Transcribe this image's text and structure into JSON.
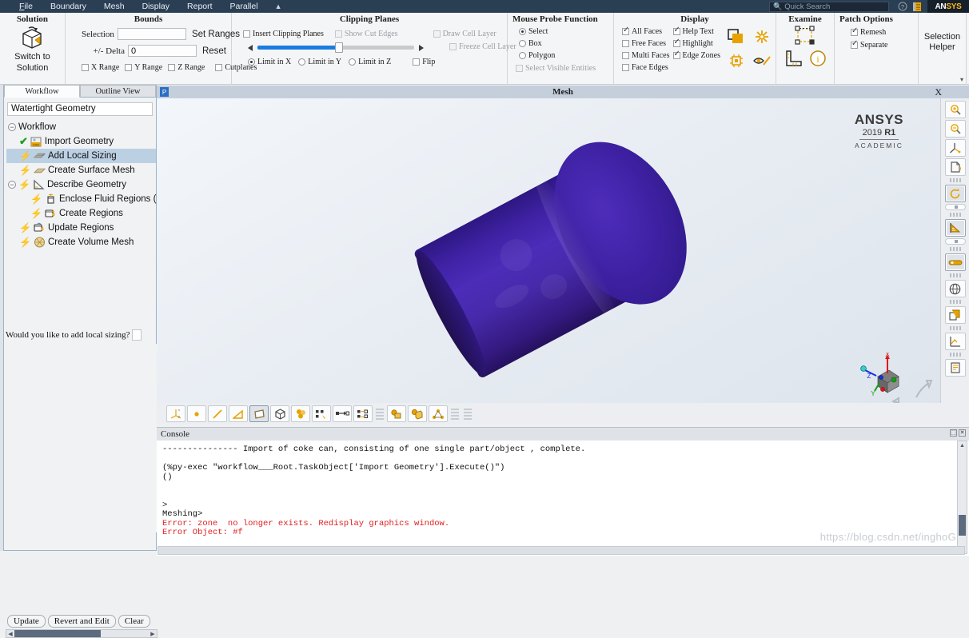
{
  "menubar": {
    "items": [
      "File",
      "Boundary",
      "Mesh",
      "Display",
      "Report",
      "Parallel"
    ],
    "caret": "▲",
    "search_placeholder": "Quick Search",
    "search_icon": "search-icon",
    "help_icon": "help-icon",
    "book_icon": "manual-icon",
    "logo": "ANSYS",
    "logo_accent": "#ffb71b"
  },
  "ribbon": {
    "solution": {
      "title": "Solution",
      "switch_line1": "Switch to",
      "switch_line2": "Solution",
      "icon": "switch-to-solution-icon"
    },
    "bounds": {
      "title": "Bounds",
      "selection_label": "Selection",
      "selection_value": "",
      "delta_label": "+/- Delta",
      "delta_value": "0",
      "set_ranges": "Set Ranges",
      "reset": "Reset",
      "checks": [
        {
          "label": "X Range",
          "checked": false
        },
        {
          "label": "Y Range",
          "checked": false
        },
        {
          "label": "Z Range",
          "checked": false
        },
        {
          "label": "Cutplanes",
          "checked": false
        }
      ]
    },
    "clipping": {
      "title": "Clipping Planes",
      "insert": {
        "label": "Insert Clipping Planes",
        "checked": false,
        "enabled": true
      },
      "show_cut_edges": {
        "label": "Show Cut Edges",
        "checked": false,
        "enabled": false
      },
      "draw_cell_layer": {
        "label": "Draw Cell Layer",
        "checked": false,
        "enabled": false
      },
      "freeze_cell_layer": {
        "label": "Freeze Cell Layer",
        "checked": false,
        "enabled": false
      },
      "slider_value": 52,
      "arrow_left": "◀",
      "arrow_right": "▶",
      "limits": [
        {
          "label": "Limit in X",
          "selected": true
        },
        {
          "label": "Limit in Y",
          "selected": false
        },
        {
          "label": "Limit in Z",
          "selected": false
        }
      ],
      "flip": {
        "label": "Flip",
        "checked": false
      }
    },
    "probe": {
      "title": "Mouse Probe Function",
      "options": [
        {
          "label": "Select",
          "selected": true
        },
        {
          "label": "Box",
          "selected": false
        },
        {
          "label": "Polygon",
          "selected": false
        }
      ],
      "select_visible": {
        "label": "Select Visible Entities",
        "checked": false,
        "enabled": false
      }
    },
    "display": {
      "title": "Display",
      "col1": [
        {
          "label": "All Faces",
          "checked": true
        },
        {
          "label": "Free Faces",
          "checked": false
        },
        {
          "label": "Multi Faces",
          "checked": false
        },
        {
          "label": "Face Edges",
          "checked": false
        }
      ],
      "col2": [
        {
          "label": "Help Text",
          "checked": true
        },
        {
          "label": "Highlight",
          "checked": true
        },
        {
          "label": "Edge Zones",
          "checked": true
        }
      ],
      "icons": [
        "window-layers-icon",
        "snowflake-icon",
        "chip-icon",
        "eye-icon"
      ]
    },
    "examine": {
      "title": "Examine",
      "icons": [
        "bounding-box-icon",
        "ruler-icon",
        "info-icon"
      ]
    },
    "patch": {
      "title": "Patch Options",
      "checks": [
        {
          "label": "Remesh",
          "checked": true
        },
        {
          "label": "Separate",
          "checked": true
        }
      ]
    },
    "selection_helper": {
      "line1": "Selection",
      "line2": "Helper",
      "more_caret": "▾"
    }
  },
  "left_panel": {
    "tabs": [
      {
        "label": "Workflow",
        "active": true
      },
      {
        "label": "Outline View",
        "active": false
      }
    ],
    "workflow_type": "Watertight Geometry",
    "root": {
      "label": "Workflow",
      "expander": "−"
    },
    "tree": [
      {
        "label": "Import Geometry",
        "state": "done",
        "icon": "cad-import-icon",
        "indent": 0,
        "selected": false,
        "expander": null
      },
      {
        "label": "Add Local Sizing",
        "state": "pending",
        "icon": "local-sizing-icon",
        "indent": 0,
        "selected": true,
        "expander": null
      },
      {
        "label": "Create Surface Mesh",
        "state": "pending",
        "icon": "surface-mesh-icon",
        "indent": 0,
        "selected": false,
        "expander": null
      },
      {
        "label": "Describe Geometry",
        "state": "pending",
        "icon": "describe-geometry-icon",
        "indent": 0,
        "selected": false,
        "expander": "−"
      },
      {
        "label": "Enclose Fluid Regions (Capp",
        "state": "pending",
        "icon": "enclose-fluid-icon",
        "indent": 1,
        "selected": false,
        "expander": null
      },
      {
        "label": "Create Regions",
        "state": "pending",
        "icon": "create-regions-icon",
        "indent": 1,
        "selected": false,
        "expander": null
      },
      {
        "label": "Update Regions",
        "state": "pending",
        "icon": "update-regions-icon",
        "indent": 0,
        "selected": false,
        "expander": null
      },
      {
        "label": "Create Volume Mesh",
        "state": "pending",
        "icon": "volume-mesh-icon",
        "indent": 0,
        "selected": false,
        "expander": null
      }
    ],
    "prompt": "Would you like to add local sizing?",
    "buttons": [
      "Update",
      "Revert and Edit",
      "Clear"
    ]
  },
  "graphics": {
    "title": "Mesh",
    "pin_icon": "pin-icon",
    "close_label": "X",
    "watermark": {
      "brand": "ANSYS",
      "version_year": "2019",
      "version_release": "R1",
      "license": "ACADEMIC"
    },
    "triad": {
      "axes": [
        "X",
        "Y",
        "Z"
      ],
      "x_color": "#e01515",
      "y_color": "#12a012",
      "z_color": "#1530e0"
    },
    "vertical_toolbar": [
      "zoom-in-icon",
      "zoom-out-icon",
      "axis-triad-icon",
      "fit-to-window-icon",
      "rotate-view-icon",
      "slider-opacity-1",
      "lighting-icon",
      "slider-opacity-2",
      "color-bar-icon",
      "perspective-icon",
      "copy-view-icon",
      "chart-axes-icon",
      "report-icon"
    ],
    "horizontal_toolbar": [
      "axis-probe-icon",
      "point-select-icon",
      "line-select-icon",
      "area-select-icon",
      "face-select-icon",
      "box-select-icon",
      "cell-select-icon",
      "zone-select-icon",
      "connect-select-icon",
      "grid-select-icon",
      "object-select-icon",
      "volume-select-icon",
      "node-select-icon"
    ]
  },
  "console": {
    "title": "Console",
    "lines": [
      {
        "text": "--------------- Import of coke can, consisting of one single part/object , complete.",
        "error": false
      },
      {
        "text": "",
        "error": false
      },
      {
        "text": "(%py-exec \"workflow___Root.TaskObject['Import Geometry'].Execute()\")",
        "error": false
      },
      {
        "text": "()",
        "error": false
      },
      {
        "text": "",
        "error": false
      },
      {
        "text": "",
        "error": false
      },
      {
        "text": ">",
        "error": false
      },
      {
        "text": "Meshing>",
        "error": false
      },
      {
        "text": "Error: zone  no longer exists. Redisplay graphics window.",
        "error": true
      },
      {
        "text": "Error Object: #f",
        "error": true
      }
    ]
  },
  "watermark_url": "https://blog.csdn.net/inghoG",
  "colors": {
    "menubar_bg": "#2b3f54",
    "accent_gold": "#e8a200",
    "mesh_purple": "#3f22a5",
    "error_red": "#e02020",
    "selection_blue": "#bcd0e4"
  }
}
